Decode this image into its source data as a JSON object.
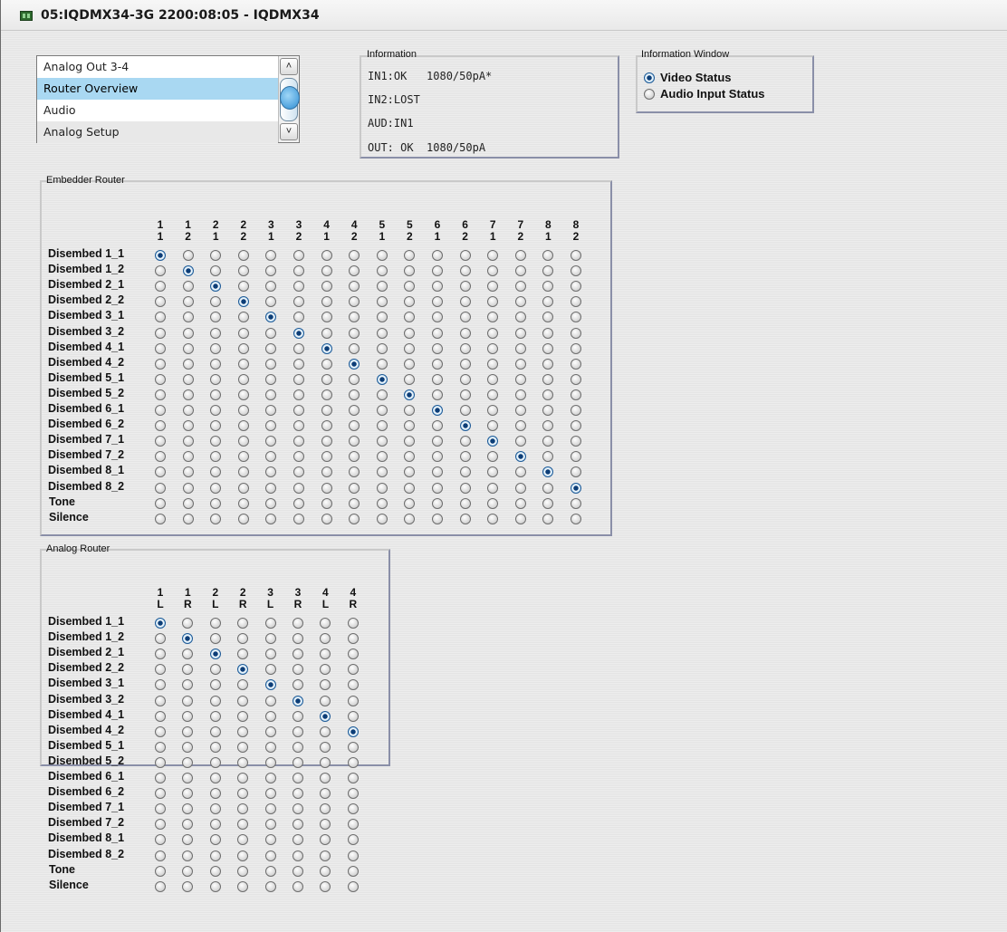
{
  "window": {
    "title": "05:IQDMX34-3G  2200:08:05  - IQDMX34"
  },
  "nav_list": {
    "items": [
      {
        "label": "Analog Out 3-4",
        "selected": false
      },
      {
        "label": "Router Overview",
        "selected": true
      },
      {
        "label": "Audio",
        "selected": false
      },
      {
        "label": "Analog Setup",
        "selected": false
      }
    ],
    "scroll_up": "˄",
    "scroll_down": "˅"
  },
  "information": {
    "title": "Information",
    "lines": [
      "IN1:OK   1080/50pA*",
      "IN2:LOST",
      "AUD:IN1",
      "OUT: OK  1080/50pA"
    ]
  },
  "information_window": {
    "title": "Information Window",
    "options": [
      {
        "label": "Video Status",
        "checked": true
      },
      {
        "label": "Audio Input Status",
        "checked": false
      }
    ]
  },
  "embedder_router": {
    "title": "Embedder Router",
    "columns": [
      [
        "1",
        "1"
      ],
      [
        "1",
        "2"
      ],
      [
        "2",
        "1"
      ],
      [
        "2",
        "2"
      ],
      [
        "3",
        "1"
      ],
      [
        "3",
        "2"
      ],
      [
        "4",
        "1"
      ],
      [
        "4",
        "2"
      ],
      [
        "5",
        "1"
      ],
      [
        "5",
        "2"
      ],
      [
        "6",
        "1"
      ],
      [
        "6",
        "2"
      ],
      [
        "7",
        "1"
      ],
      [
        "7",
        "2"
      ],
      [
        "8",
        "1"
      ],
      [
        "8",
        "2"
      ]
    ],
    "rows": [
      "Disembed 1_1",
      "Disembed 1_2",
      "Disembed 2_1",
      "Disembed 2_2",
      "Disembed 3_1",
      "Disembed 3_2",
      "Disembed 4_1",
      "Disembed 4_2",
      "Disembed 5_1",
      "Disembed 5_2",
      "Disembed 6_1",
      "Disembed 6_2",
      "Disembed 7_1",
      "Disembed 7_2",
      "Disembed 8_1",
      "Disembed 8_2",
      "Tone",
      "Silence"
    ],
    "selected_row_per_column": [
      0,
      1,
      2,
      3,
      4,
      5,
      6,
      7,
      8,
      9,
      10,
      11,
      12,
      13,
      14,
      15
    ]
  },
  "analog_router": {
    "title": "Analog Router",
    "columns": [
      [
        "1",
        "L"
      ],
      [
        "1",
        "R"
      ],
      [
        "2",
        "L"
      ],
      [
        "2",
        "R"
      ],
      [
        "3",
        "L"
      ],
      [
        "3",
        "R"
      ],
      [
        "4",
        "L"
      ],
      [
        "4",
        "R"
      ]
    ],
    "rows": [
      "Disembed 1_1",
      "Disembed 1_2",
      "Disembed 2_1",
      "Disembed 2_2",
      "Disembed 3_1",
      "Disembed 3_2",
      "Disembed 4_1",
      "Disembed 4_2",
      "Disembed 5_1",
      "Disembed 5_2",
      "Disembed 6_1",
      "Disembed 6_2",
      "Disembed 7_1",
      "Disembed 7_2",
      "Disembed 8_1",
      "Disembed 8_2",
      "Tone",
      "Silence"
    ],
    "selected_row_per_column": [
      0,
      1,
      2,
      3,
      4,
      5,
      6,
      7
    ]
  }
}
